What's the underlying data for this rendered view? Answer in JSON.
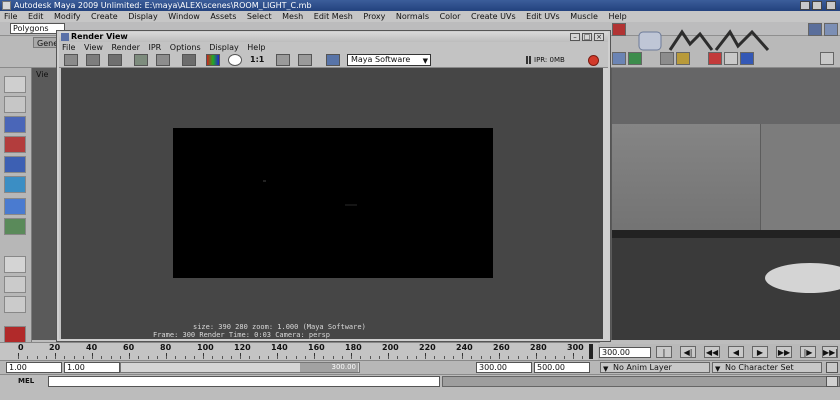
{
  "window": {
    "title": "Autodesk Maya 2009 Unlimited: E:\\maya\\ALEX\\scenes\\ROOM_LIGHT_C.mb"
  },
  "menubar": [
    "File",
    "Edit",
    "Modify",
    "Create",
    "Display",
    "Window",
    "Assets",
    "Select",
    "Mesh",
    "Edit Mesh",
    "Proxy",
    "Normals",
    "Color",
    "Create UVs",
    "Edit UVs",
    "Muscle",
    "Help"
  ],
  "statusline": {
    "menu_set": "Polygons"
  },
  "shelf": {
    "tab_general": "Gene"
  },
  "viewport": {
    "menu_label": "Vie"
  },
  "render_view": {
    "title": "Render View",
    "menu": [
      "File",
      "View",
      "Render",
      "IPR",
      "Options",
      "Display",
      "Help"
    ],
    "ratio_label": "1:1",
    "renderer": "Maya Software",
    "ipr_label": "IPR: 0MB",
    "info": {
      "line1": "size:  390  280 zoom: 1.000          (Maya Software)",
      "line2": "Frame: 300          Render Time: 0:03            Camera: persp"
    }
  },
  "time_slider": {
    "ticks": [
      "0",
      "20",
      "40",
      "60",
      "80",
      "100",
      "120",
      "140",
      "160",
      "180",
      "200",
      "220",
      "240",
      "260",
      "280",
      "300"
    ],
    "current_frame": "300.00",
    "buttons": [
      "|◀◀",
      "◀|",
      "◀◀",
      "◀",
      "▶",
      "▶▶",
      "|▶",
      "▶▶|"
    ]
  },
  "range_slider": {
    "start_time": "1.00",
    "playback_start": "1.00",
    "bar_value": "300.00",
    "playback_end": "300.00",
    "end_time": "500.00",
    "anim_layer": "No Anim Layer",
    "character_set": "No Character Set"
  },
  "command_line": {
    "label": "MEL"
  },
  "colors": {
    "title_blue": "#23427e",
    "panel_gray": "#c3c3c3",
    "canvas_gray": "#464646",
    "ipr_red": "#d23a2a"
  }
}
